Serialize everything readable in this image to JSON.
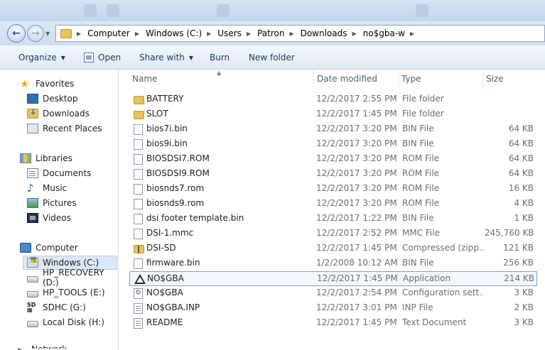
{
  "address": {
    "crumbs": [
      "Computer",
      "Windows (C:)",
      "Users",
      "Patron",
      "Downloads",
      "no$gba-w"
    ]
  },
  "toolbar": {
    "organize": "Organize",
    "open": "Open",
    "share_with": "Share with",
    "burn": "Burn",
    "new_folder": "New folder"
  },
  "nav": {
    "favorites": "Favorites",
    "desktop": "Desktop",
    "downloads": "Downloads",
    "recent_places": "Recent Places",
    "libraries": "Libraries",
    "documents": "Documents",
    "music": "Music",
    "pictures": "Pictures",
    "videos": "Videos",
    "computer": "Computer",
    "drives": [
      "Windows (C:)",
      "HP_RECOVERY (D:)",
      "HP_TOOLS (E:)",
      "SDHC (G:)",
      "Local Disk (H:)"
    ],
    "network": "Network"
  },
  "columns": {
    "name": "Name",
    "date": "Date modified",
    "type": "Type",
    "size": "Size"
  },
  "files": [
    {
      "name": "BATTERY",
      "date": "12/2/2017 2:55 PM",
      "type": "File folder",
      "size": "",
      "icon": "folder-icon"
    },
    {
      "name": "SLOT",
      "date": "12/2/2017 1:45 PM",
      "type": "File folder",
      "size": "",
      "icon": "folder-icon"
    },
    {
      "name": "bios7i.bin",
      "date": "12/2/2017 3:20 PM",
      "type": "BIN File",
      "size": "64 KB",
      "icon": "file-icon"
    },
    {
      "name": "bios9i.bin",
      "date": "12/2/2017 3:20 PM",
      "type": "BIN File",
      "size": "64 KB",
      "icon": "file-icon"
    },
    {
      "name": "BIOSDSI7.ROM",
      "date": "12/2/2017 3:20 PM",
      "type": "ROM File",
      "size": "64 KB",
      "icon": "file-icon"
    },
    {
      "name": "BIOSDSI9.ROM",
      "date": "12/2/2017 3:20 PM",
      "type": "ROM File",
      "size": "64 KB",
      "icon": "file-icon"
    },
    {
      "name": "biosnds7.rom",
      "date": "12/2/2017 3:20 PM",
      "type": "ROM File",
      "size": "16 KB",
      "icon": "file-icon"
    },
    {
      "name": "biosnds9.rom",
      "date": "12/2/2017 3:20 PM",
      "type": "ROM File",
      "size": "4 KB",
      "icon": "file-icon"
    },
    {
      "name": "dsi footer template.bin",
      "date": "12/2/2017 1:22 PM",
      "type": "BIN File",
      "size": "1 KB",
      "icon": "file-icon"
    },
    {
      "name": "DSI-1.mmc",
      "date": "12/2/2017 2:52 PM",
      "type": "MMC File",
      "size": "245,760 KB",
      "icon": "file-icon"
    },
    {
      "name": "DSI-SD",
      "date": "12/2/2017 1:45 PM",
      "type": "Compressed (zipp...",
      "size": "121 KB",
      "icon": "zip-folder-icon"
    },
    {
      "name": "firmware.bin",
      "date": "1/2/2008 10:12 AM",
      "type": "BIN File",
      "size": "256 KB",
      "icon": "file-icon"
    },
    {
      "name": "NO$GBA",
      "date": "12/2/2017 1:45 PM",
      "type": "Application",
      "size": "214 KB",
      "icon": "app-icon",
      "selected": true
    },
    {
      "name": "NO$GBA",
      "date": "12/2/2017 2:54 PM",
      "type": "Configuration sett...",
      "size": "3 KB",
      "icon": "config-file-icon"
    },
    {
      "name": "NO$GBA.INP",
      "date": "12/2/2017 3:01 PM",
      "type": "INP File",
      "size": "2 KB",
      "icon": "text-file-icon"
    },
    {
      "name": "README",
      "date": "12/2/2017 1:45 PM",
      "type": "Text Document",
      "size": "3 KB",
      "icon": "text-file-icon"
    }
  ]
}
